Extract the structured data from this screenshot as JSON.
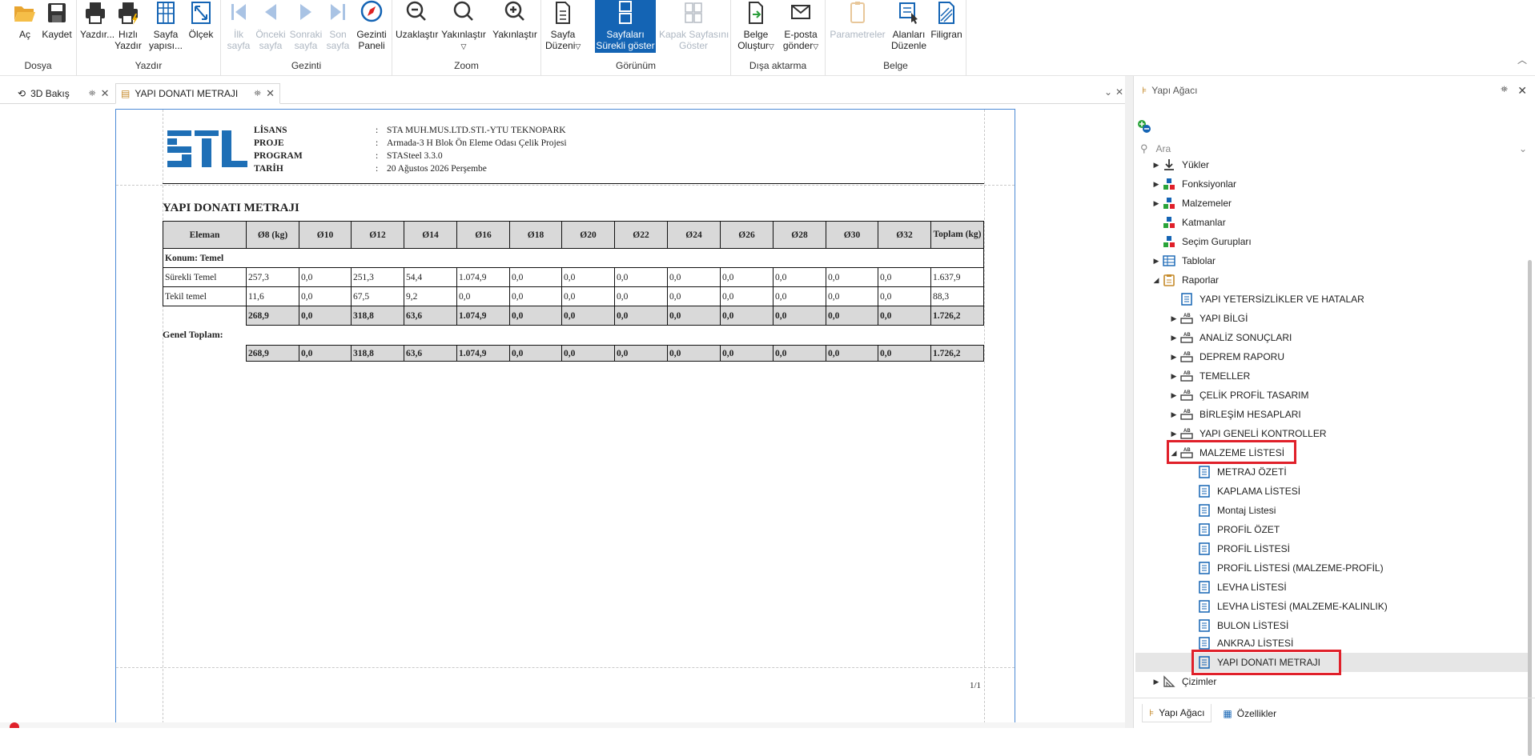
{
  "ribbon": {
    "groups": {
      "dosya": "Dosya",
      "yazdir": "Yazdır",
      "gezinti": "Gezinti",
      "zoom": "Zoom",
      "gorunum": "Görünüm",
      "disa": "Dışa aktarma",
      "belge": "Belge"
    },
    "ac": "Aç",
    "kaydet": "Kaydet",
    "yazdir": "Yazdır...",
    "hizli1": "Hızlı",
    "hizli2": "Yazdır",
    "sayfa_yapisi1": "Sayfa",
    "sayfa_yapisi2": "yapısı...",
    "olcek": "Ölçek",
    "ilk1": "İlk",
    "ilk2": "sayfa",
    "onceki1": "Önceki",
    "onceki2": "sayfa",
    "sonraki1": "Sonraki",
    "sonraki2": "sayfa",
    "son1": "Son",
    "son2": "sayfa",
    "gezinti1": "Gezinti",
    "gezinti2": "Paneli",
    "uzaklastir": "Uzaklaştır",
    "yakinlastir_dd": "Yakınlaştır",
    "yakinlastir": "Yakınlaştır",
    "sayfa_duzeni1": "Sayfa",
    "sayfa_duzeni2": "Düzeni",
    "surekli1": "Sayfaları",
    "surekli2": "Sürekli göster",
    "kapak1": "Kapak Sayfasını",
    "kapak2": "Göster",
    "belge_olustur1": "Belge",
    "belge_olustur2": "Oluştur",
    "eposta1": "E-posta",
    "eposta2": "gönder",
    "parametreler": "Parametreler",
    "alanlari1": "Alanları",
    "alanlari2": "Düzenle",
    "filigran": "Filigran"
  },
  "tabs": [
    "3D Bakış",
    "YAPI DONATI METRAJI"
  ],
  "report": {
    "header": [
      {
        "k": "LİSANS",
        "v": "STA MUH.MUS.LTD.STI.-YTU TEKNOPARK"
      },
      {
        "k": "PROJE",
        "v": " Armada-3 H Blok Ön Eleme Odası Çelik Projesi"
      },
      {
        "k": "PROGRAM",
        "v": "STASteel 3.3.0"
      },
      {
        "k": "TARİH",
        "v": "20 Ağustos 2026 Perşembe"
      }
    ],
    "colon": ":",
    "title": "YAPI DONATI METRAJI",
    "columns": [
      "Eleman",
      "Ø8 (kg)",
      "Ø10",
      "Ø12",
      "Ø14",
      "Ø16",
      "Ø18",
      "Ø20",
      "Ø22",
      "Ø24",
      "Ø26",
      "Ø28",
      "Ø30",
      "Ø32",
      "Toplam (kg)"
    ],
    "konum": "Konum: Temel",
    "rows": [
      [
        "Sürekli Temel",
        "257,3",
        "0,0",
        "251,3",
        "54,4",
        "1.074,9",
        "0,0",
        "0,0",
        "0,0",
        "0,0",
        "0,0",
        "0,0",
        "0,0",
        "0,0",
        "1.637,9"
      ],
      [
        "Tekil temel",
        "11,6",
        "0,0",
        "67,5",
        "9,2",
        "0,0",
        "0,0",
        "0,0",
        "0,0",
        "0,0",
        "0,0",
        "0,0",
        "0,0",
        "0,0",
        "88,3"
      ]
    ],
    "subtotal": [
      "268,9",
      "0,0",
      "318,8",
      "63,6",
      "1.074,9",
      "0,0",
      "0,0",
      "0,0",
      "0,0",
      "0,0",
      "0,0",
      "0,0",
      "0,0",
      "1.726,2"
    ],
    "genel_label": "Genel Toplam:",
    "genel": [
      "268,9",
      "0,0",
      "318,8",
      "63,6",
      "1.074,9",
      "0,0",
      "0,0",
      "0,0",
      "0,0",
      "0,0",
      "0,0",
      "0,0",
      "0,0",
      "1.726,2"
    ],
    "page": "1/1"
  },
  "tree": {
    "title": "Yapı Ağacı",
    "search_placeholder": "Ara",
    "items": [
      "Yükler",
      "Fonksiyonlar",
      "Malzemeler",
      "Katmanlar",
      "Seçim Gurupları",
      "Tablolar",
      "Raporlar",
      "YAPI YETERSİZLİKLER VE HATALAR",
      "YAPI BİLGİ",
      "ANALİZ SONUÇLARI",
      "DEPREM RAPORU",
      "TEMELLER",
      "ÇELİK PROFİL TASARIM",
      "BİRLEŞİM HESAPLARI",
      "YAPI GENELİ KONTROLLER",
      "MALZEME LİSTESİ",
      "METRAJ ÖZETİ",
      "KAPLAMA LİSTESİ",
      "Montaj Listesi",
      "PROFİL ÖZET",
      "PROFİL LİSTESİ",
      "PROFİL LİSTESİ (MALZEME-PROFİL)",
      "LEVHA LİSTESİ",
      "LEVHA LİSTESİ (MALZEME-KALINLIK)",
      "BULON LİSTESİ",
      "ANKRAJ LİSTESİ",
      "YAPI DONATI METRAJI",
      "Çizimler"
    ],
    "bottom_tabs": [
      "Yapı Ağacı",
      "Özellikler"
    ]
  },
  "colors": {
    "accent": "#1464b4",
    "highlight": "#e0202a",
    "page_border": "#4d8bd6"
  }
}
